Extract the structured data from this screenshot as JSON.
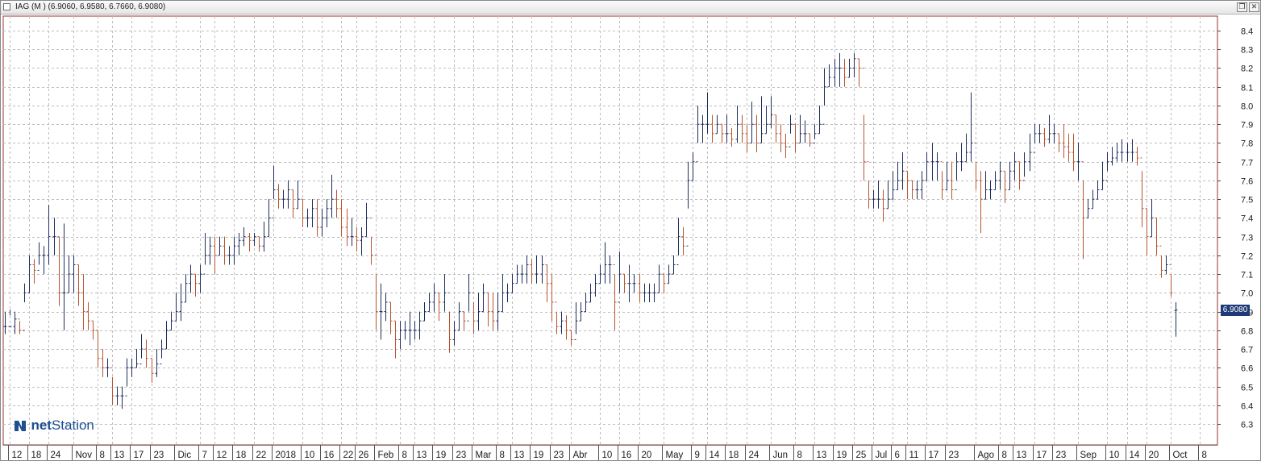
{
  "window": {
    "title": "IAG (M ) (6.9060, 6.9580, 6.7660, 6.9080)",
    "restore_glyph": "❐",
    "close_glyph": "✕"
  },
  "logo": {
    "part1": "net",
    "part2": "Station",
    "icon": "netstation-logo-mark"
  },
  "last_price_label": "6.9080",
  "colors": {
    "up": "#1f2d5c",
    "down": "#b8552f",
    "grid": "#bdbdbd",
    "frame": "#9a3030",
    "badge": "#1f3a78"
  },
  "chart_data": {
    "type": "ohlc",
    "title": "IAG (M )",
    "last_values": {
      "open": 6.906,
      "high": 6.958,
      "low": 6.766,
      "close": 6.908
    },
    "y_axis": {
      "min": 6.2,
      "max": 8.45,
      "ticks": [
        6.3,
        6.4,
        6.5,
        6.6,
        6.7,
        6.8,
        6.9,
        7.0,
        7.1,
        7.2,
        7.3,
        7.4,
        7.5,
        7.6,
        7.7,
        7.8,
        7.9,
        8.0,
        8.1,
        8.2,
        8.3,
        8.4
      ]
    },
    "grid": true,
    "x_labels": [
      {
        "t": "12",
        "i": 1
      },
      {
        "t": "18",
        "i": 5
      },
      {
        "t": "24",
        "i": 9
      },
      {
        "t": "Nov",
        "i": 14
      },
      {
        "t": "8",
        "i": 19
      },
      {
        "t": "13",
        "i": 22
      },
      {
        "t": "17",
        "i": 26
      },
      {
        "t": "23",
        "i": 30
      },
      {
        "t": "Dic",
        "i": 35
      },
      {
        "t": "7",
        "i": 40
      },
      {
        "t": "12",
        "i": 43
      },
      {
        "t": "18",
        "i": 47
      },
      {
        "t": "22",
        "i": 51
      },
      {
        "t": "2018",
        "i": 55
      },
      {
        "t": "10",
        "i": 61
      },
      {
        "t": "16",
        "i": 65
      },
      {
        "t": "22",
        "i": 69
      },
      {
        "t": "26",
        "i": 72
      },
      {
        "t": "Feb",
        "i": 76
      },
      {
        "t": "8",
        "i": 81
      },
      {
        "t": "13",
        "i": 84
      },
      {
        "t": "19",
        "i": 88
      },
      {
        "t": "23",
        "i": 92
      },
      {
        "t": "Mar",
        "i": 96
      },
      {
        "t": "8",
        "i": 101
      },
      {
        "t": "13",
        "i": 104
      },
      {
        "t": "19",
        "i": 108
      },
      {
        "t": "23",
        "i": 112
      },
      {
        "t": "Abr",
        "i": 116
      },
      {
        "t": "10",
        "i": 122
      },
      {
        "t": "16",
        "i": 126
      },
      {
        "t": "20",
        "i": 130
      },
      {
        "t": "May",
        "i": 135
      },
      {
        "t": "9",
        "i": 141
      },
      {
        "t": "14",
        "i": 144
      },
      {
        "t": "18",
        "i": 148
      },
      {
        "t": "24",
        "i": 152
      },
      {
        "t": "Jun",
        "i": 157
      },
      {
        "t": "8",
        "i": 162
      },
      {
        "t": "13",
        "i": 166
      },
      {
        "t": "19",
        "i": 170
      },
      {
        "t": "25",
        "i": 174
      },
      {
        "t": "Jul",
        "i": 178
      },
      {
        "t": "6",
        "i": 182
      },
      {
        "t": "11",
        "i": 185
      },
      {
        "t": "17",
        "i": 189
      },
      {
        "t": "23",
        "i": 193
      },
      {
        "t": "Ago",
        "i": 199
      },
      {
        "t": "8",
        "i": 204
      },
      {
        "t": "13",
        "i": 207
      },
      {
        "t": "17",
        "i": 211
      },
      {
        "t": "23",
        "i": 215
      },
      {
        "t": "Sep",
        "i": 220
      },
      {
        "t": "10",
        "i": 226
      },
      {
        "t": "14",
        "i": 230
      },
      {
        "t": "20",
        "i": 234
      },
      {
        "t": "Oct",
        "i": 239
      },
      {
        "t": "8",
        "i": 245
      }
    ],
    "bars": [
      [
        6.9,
        6.78,
        6.82
      ],
      [
        6.88,
        6.91,
        6.82
      ],
      [
        6.9,
        6.78,
        6.86
      ],
      [
        6.85,
        6.78,
        6.8
      ],
      [
        7.05,
        6.95,
        7.0
      ],
      [
        7.2,
        7.0,
        7.15
      ],
      [
        7.18,
        7.05,
        7.12
      ],
      [
        7.27,
        7.15,
        7.2
      ],
      [
        7.25,
        7.1,
        7.2
      ],
      [
        7.47,
        7.15,
        7.3
      ],
      [
        7.4,
        7.2,
        7.3
      ],
      [
        7.3,
        6.93,
        7.0
      ],
      [
        7.37,
        6.8,
        7.0
      ],
      [
        7.2,
        7.0,
        7.1
      ],
      [
        7.2,
        7.0,
        7.15
      ],
      [
        7.15,
        6.93,
        7.0
      ],
      [
        7.1,
        6.8,
        6.9
      ],
      [
        6.95,
        6.8,
        6.85
      ],
      [
        6.85,
        6.75,
        6.8
      ],
      [
        6.8,
        6.6,
        6.65
      ],
      [
        6.7,
        6.55,
        6.6
      ],
      [
        6.65,
        6.55,
        6.6
      ],
      [
        6.55,
        6.4,
        6.45
      ],
      [
        6.5,
        6.4,
        6.45
      ],
      [
        6.5,
        6.38,
        6.45
      ],
      [
        6.65,
        6.5,
        6.6
      ],
      [
        6.65,
        6.55,
        6.6
      ],
      [
        6.7,
        6.6,
        6.62
      ],
      [
        6.78,
        6.65,
        6.7
      ],
      [
        6.75,
        6.6,
        6.65
      ],
      [
        6.65,
        6.52,
        6.57
      ],
      [
        6.7,
        6.55,
        6.62
      ],
      [
        6.75,
        6.65,
        6.7
      ],
      [
        6.85,
        6.7,
        6.8
      ],
      [
        6.9,
        6.8,
        6.85
      ],
      [
        7.0,
        6.85,
        6.9
      ],
      [
        7.05,
        6.85,
        6.95
      ],
      [
        7.1,
        6.95,
        7.05
      ],
      [
        7.15,
        7.0,
        7.1
      ],
      [
        7.1,
        6.98,
        7.05
      ],
      [
        7.15,
        7.0,
        7.1
      ],
      [
        7.32,
        7.15,
        7.2
      ],
      [
        7.3,
        7.15,
        7.25
      ],
      [
        7.3,
        7.1,
        7.2
      ],
      [
        7.3,
        7.2,
        7.25
      ],
      [
        7.3,
        7.15,
        7.2
      ],
      [
        7.25,
        7.15,
        7.2
      ],
      [
        7.3,
        7.15,
        7.25
      ],
      [
        7.32,
        7.2,
        7.28
      ],
      [
        7.35,
        7.25,
        7.3
      ],
      [
        7.32,
        7.22,
        7.28
      ],
      [
        7.32,
        7.25,
        7.3
      ],
      [
        7.3,
        7.22,
        7.25
      ],
      [
        7.38,
        7.22,
        7.3
      ],
      [
        7.5,
        7.3,
        7.4
      ],
      [
        7.68,
        7.5,
        7.55
      ],
      [
        7.58,
        7.45,
        7.5
      ],
      [
        7.55,
        7.45,
        7.5
      ],
      [
        7.6,
        7.45,
        7.55
      ],
      [
        7.55,
        7.4,
        7.45
      ],
      [
        7.6,
        7.45,
        7.5
      ],
      [
        7.5,
        7.35,
        7.4
      ],
      [
        7.45,
        7.35,
        7.4
      ],
      [
        7.5,
        7.35,
        7.45
      ],
      [
        7.5,
        7.3,
        7.35
      ],
      [
        7.45,
        7.3,
        7.4
      ],
      [
        7.5,
        7.35,
        7.45
      ],
      [
        7.63,
        7.4,
        7.5
      ],
      [
        7.55,
        7.4,
        7.45
      ],
      [
        7.5,
        7.3,
        7.35
      ],
      [
        7.45,
        7.25,
        7.3
      ],
      [
        7.4,
        7.25,
        7.3
      ],
      [
        7.35,
        7.22,
        7.28
      ],
      [
        7.35,
        7.2,
        7.3
      ],
      [
        7.48,
        7.3,
        7.4
      ],
      [
        7.3,
        7.15,
        7.2
      ],
      [
        7.1,
        6.8,
        6.9
      ],
      [
        7.05,
        6.75,
        6.9
      ],
      [
        7.0,
        6.85,
        6.95
      ],
      [
        6.95,
        6.78,
        6.85
      ],
      [
        6.85,
        6.65,
        6.75
      ],
      [
        6.85,
        6.7,
        6.8
      ],
      [
        6.85,
        6.75,
        6.8
      ],
      [
        6.9,
        6.72,
        6.8
      ],
      [
        6.85,
        6.75,
        6.8
      ],
      [
        6.9,
        6.75,
        6.85
      ],
      [
        6.95,
        6.85,
        6.9
      ],
      [
        7.0,
        6.9,
        6.95
      ],
      [
        7.05,
        6.9,
        7.0
      ],
      [
        7.0,
        6.85,
        6.95
      ],
      [
        7.1,
        6.9,
        7.0
      ],
      [
        6.9,
        6.68,
        6.75
      ],
      [
        6.85,
        6.72,
        6.8
      ],
      [
        6.95,
        6.8,
        6.9
      ],
      [
        6.9,
        6.8,
        6.85
      ],
      [
        7.1,
        6.9,
        7.0
      ],
      [
        6.95,
        6.78,
        6.85
      ],
      [
        7.0,
        6.8,
        6.9
      ],
      [
        7.05,
        6.9,
        7.0
      ],
      [
        7.0,
        6.82,
        6.9
      ],
      [
        7.0,
        6.8,
        6.85
      ],
      [
        7.0,
        6.8,
        6.9
      ],
      [
        7.1,
        6.9,
        7.0
      ],
      [
        7.05,
        6.95,
        7.0
      ],
      [
        7.1,
        7.0,
        7.05
      ],
      [
        7.15,
        7.05,
        7.1
      ],
      [
        7.15,
        7.05,
        7.1
      ],
      [
        7.2,
        7.05,
        7.15
      ],
      [
        7.18,
        7.05,
        7.1
      ],
      [
        7.2,
        7.05,
        7.1
      ],
      [
        7.2,
        7.05,
        7.15
      ],
      [
        7.15,
        6.95,
        7.05
      ],
      [
        7.1,
        6.85,
        6.95
      ],
      [
        6.9,
        6.78,
        6.82
      ],
      [
        6.9,
        6.78,
        6.85
      ],
      [
        6.88,
        6.75,
        6.8
      ],
      [
        6.8,
        6.72,
        6.75
      ],
      [
        6.95,
        6.78,
        6.85
      ],
      [
        6.95,
        6.85,
        6.9
      ],
      [
        7.0,
        6.9,
        6.95
      ],
      [
        7.05,
        6.95,
        7.0
      ],
      [
        7.1,
        6.98,
        7.05
      ],
      [
        7.15,
        7.05,
        7.1
      ],
      [
        7.27,
        7.05,
        7.15
      ],
      [
        7.2,
        7.05,
        7.15
      ],
      [
        7.1,
        6.8,
        6.95
      ],
      [
        7.22,
        7.0,
        7.1
      ],
      [
        7.1,
        7.0,
        7.05
      ],
      [
        7.15,
        6.95,
        7.05
      ],
      [
        7.1,
        7.0,
        7.05
      ],
      [
        7.1,
        6.95,
        7.0
      ],
      [
        7.05,
        6.95,
        7.0
      ],
      [
        7.05,
        6.95,
        7.0
      ],
      [
        7.05,
        6.95,
        7.0
      ],
      [
        7.15,
        7.0,
        7.1
      ],
      [
        7.1,
        7.0,
        7.05
      ],
      [
        7.15,
        7.05,
        7.1
      ],
      [
        7.2,
        7.1,
        7.15
      ],
      [
        7.4,
        7.2,
        7.3
      ],
      [
        7.35,
        7.2,
        7.25
      ],
      [
        7.7,
        7.45,
        7.6
      ],
      [
        7.75,
        7.6,
        7.7
      ],
      [
        8.0,
        7.8,
        7.9
      ],
      [
        7.95,
        7.8,
        7.9
      ],
      [
        8.07,
        7.85,
        7.9
      ],
      [
        7.95,
        7.8,
        7.85
      ],
      [
        7.95,
        7.85,
        7.9
      ],
      [
        7.9,
        7.8,
        7.85
      ],
      [
        7.95,
        7.8,
        7.85
      ],
      [
        7.88,
        7.78,
        7.82
      ],
      [
        8.0,
        7.8,
        7.9
      ],
      [
        7.95,
        7.8,
        7.85
      ],
      [
        7.9,
        7.75,
        7.8
      ],
      [
        8.02,
        7.8,
        7.9
      ],
      [
        7.95,
        7.75,
        7.8
      ],
      [
        8.05,
        7.8,
        7.85
      ],
      [
        8.0,
        7.85,
        7.9
      ],
      [
        8.05,
        7.88,
        7.95
      ],
      [
        7.95,
        7.8,
        7.85
      ],
      [
        7.9,
        7.75,
        7.8
      ],
      [
        7.85,
        7.72,
        7.78
      ],
      [
        7.95,
        7.85,
        7.9
      ],
      [
        7.9,
        7.75,
        7.8
      ],
      [
        7.95,
        7.8,
        7.85
      ],
      [
        7.92,
        7.8,
        7.85
      ],
      [
        7.85,
        7.78,
        7.8
      ],
      [
        7.9,
        7.82,
        7.85
      ],
      [
        8.0,
        7.85,
        7.9
      ],
      [
        8.2,
        8.0,
        8.1
      ],
      [
        8.22,
        8.1,
        8.15
      ],
      [
        8.25,
        8.1,
        8.2
      ],
      [
        8.28,
        8.1,
        8.2
      ],
      [
        8.25,
        8.1,
        8.15
      ],
      [
        8.25,
        8.15,
        8.2
      ],
      [
        8.28,
        8.15,
        8.25
      ],
      [
        8.25,
        8.1,
        8.2
      ],
      [
        7.95,
        7.6,
        7.7
      ],
      [
        7.6,
        7.45,
        7.5
      ],
      [
        7.55,
        7.45,
        7.5
      ],
      [
        7.6,
        7.45,
        7.5
      ],
      [
        7.55,
        7.38,
        7.45
      ],
      [
        7.6,
        7.45,
        7.5
      ],
      [
        7.65,
        7.5,
        7.55
      ],
      [
        7.7,
        7.55,
        7.6
      ],
      [
        7.75,
        7.55,
        7.65
      ],
      [
        7.65,
        7.5,
        7.6
      ],
      [
        7.6,
        7.5,
        7.55
      ],
      [
        7.6,
        7.5,
        7.55
      ],
      [
        7.65,
        7.5,
        7.6
      ],
      [
        7.75,
        7.6,
        7.7
      ],
      [
        7.8,
        7.6,
        7.7
      ],
      [
        7.75,
        7.6,
        7.7
      ],
      [
        7.65,
        7.5,
        7.55
      ],
      [
        7.7,
        7.55,
        7.6
      ],
      [
        7.7,
        7.5,
        7.55
      ],
      [
        7.75,
        7.6,
        7.7
      ],
      [
        7.8,
        7.65,
        7.7
      ],
      [
        7.85,
        7.7,
        7.75
      ],
      [
        8.07,
        7.7,
        7.8
      ],
      [
        7.7,
        7.55,
        7.6
      ],
      [
        7.65,
        7.32,
        7.5
      ],
      [
        7.65,
        7.5,
        7.55
      ],
      [
        7.6,
        7.5,
        7.55
      ],
      [
        7.65,
        7.55,
        7.6
      ],
      [
        7.7,
        7.55,
        7.65
      ],
      [
        7.65,
        7.48,
        7.55
      ],
      [
        7.7,
        7.55,
        7.65
      ],
      [
        7.75,
        7.6,
        7.7
      ],
      [
        7.7,
        7.55,
        7.6
      ],
      [
        7.75,
        7.62,
        7.7
      ],
      [
        7.85,
        7.65,
        7.75
      ],
      [
        7.9,
        7.8,
        7.85
      ],
      [
        7.9,
        7.8,
        7.85
      ],
      [
        7.88,
        7.78,
        7.82
      ],
      [
        7.95,
        7.8,
        7.85
      ],
      [
        7.9,
        7.8,
        7.85
      ],
      [
        7.85,
        7.75,
        7.8
      ],
      [
        7.9,
        7.72,
        7.78
      ],
      [
        7.85,
        7.7,
        7.75
      ],
      [
        7.85,
        7.65,
        7.7
      ],
      [
        7.8,
        7.6,
        7.7
      ],
      [
        7.6,
        7.18,
        7.4
      ],
      [
        7.5,
        7.4,
        7.45
      ],
      [
        7.55,
        7.45,
        7.5
      ],
      [
        7.6,
        7.5,
        7.55
      ],
      [
        7.7,
        7.55,
        7.6
      ],
      [
        7.75,
        7.65,
        7.7
      ],
      [
        7.78,
        7.68,
        7.72
      ],
      [
        7.8,
        7.7,
        7.75
      ],
      [
        7.82,
        7.7,
        7.75
      ],
      [
        7.8,
        7.7,
        7.75
      ],
      [
        7.82,
        7.7,
        7.75
      ],
      [
        7.78,
        7.68,
        7.72
      ],
      [
        7.65,
        7.35,
        7.45
      ],
      [
        7.45,
        7.2,
        7.3
      ],
      [
        7.5,
        7.3,
        7.4
      ],
      [
        7.4,
        7.2,
        7.25
      ],
      [
        7.2,
        7.08,
        7.12
      ],
      [
        7.2,
        7.1,
        7.15
      ],
      [
        7.1,
        6.98,
        7.0
      ],
      [
        6.95,
        6.766,
        6.908
      ]
    ]
  }
}
